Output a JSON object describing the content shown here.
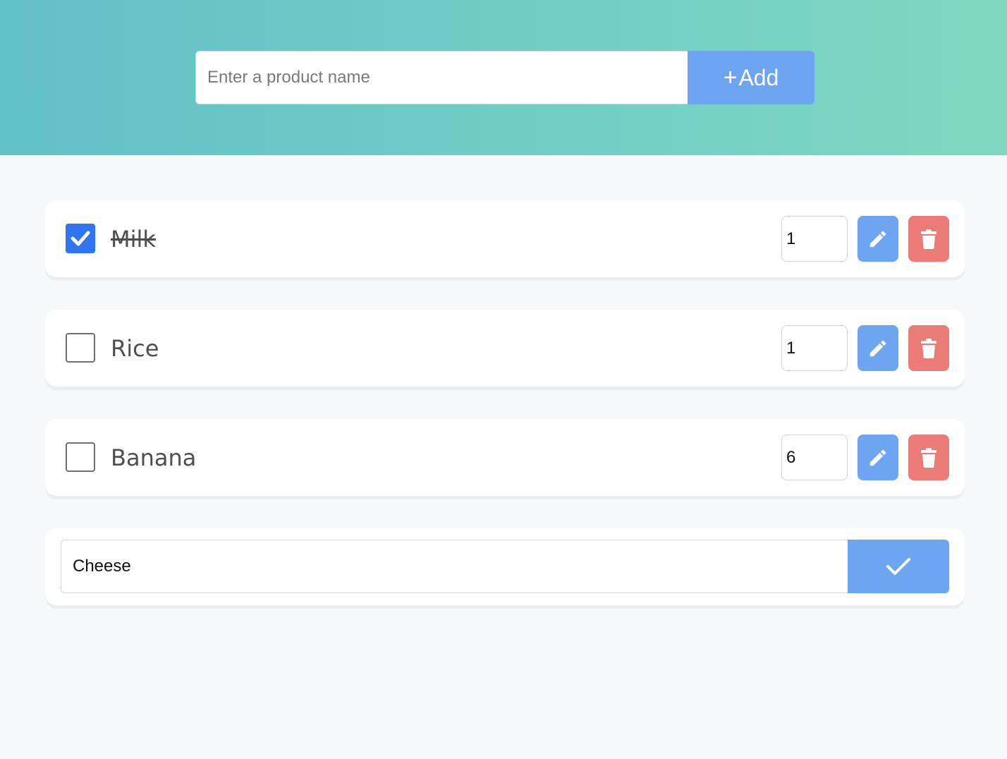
{
  "header": {
    "input_placeholder": "Enter a product name",
    "input_value": "",
    "add_icon": "plus-icon",
    "add_label": "Add",
    "gradient_start": "#62c0c9",
    "gradient_end": "#7ed9c0"
  },
  "items": [
    {
      "name": "Milk",
      "checked": true,
      "quantity": "1"
    },
    {
      "name": "Rice",
      "checked": false,
      "quantity": "1"
    },
    {
      "name": "Banana",
      "checked": false,
      "quantity": "6"
    }
  ],
  "edit_row": {
    "value": "Cheese",
    "confirm_icon": "check-icon"
  },
  "colors": {
    "accent_blue": "#6ea5f3",
    "checkbox_blue": "#2f74f2",
    "delete_red": "#ea7b77",
    "text": "#4f4f4f",
    "background": "#f7f8fa"
  },
  "icons": {
    "edit": "pencil-icon",
    "delete": "trash-icon",
    "checked": "checkmark-icon"
  }
}
